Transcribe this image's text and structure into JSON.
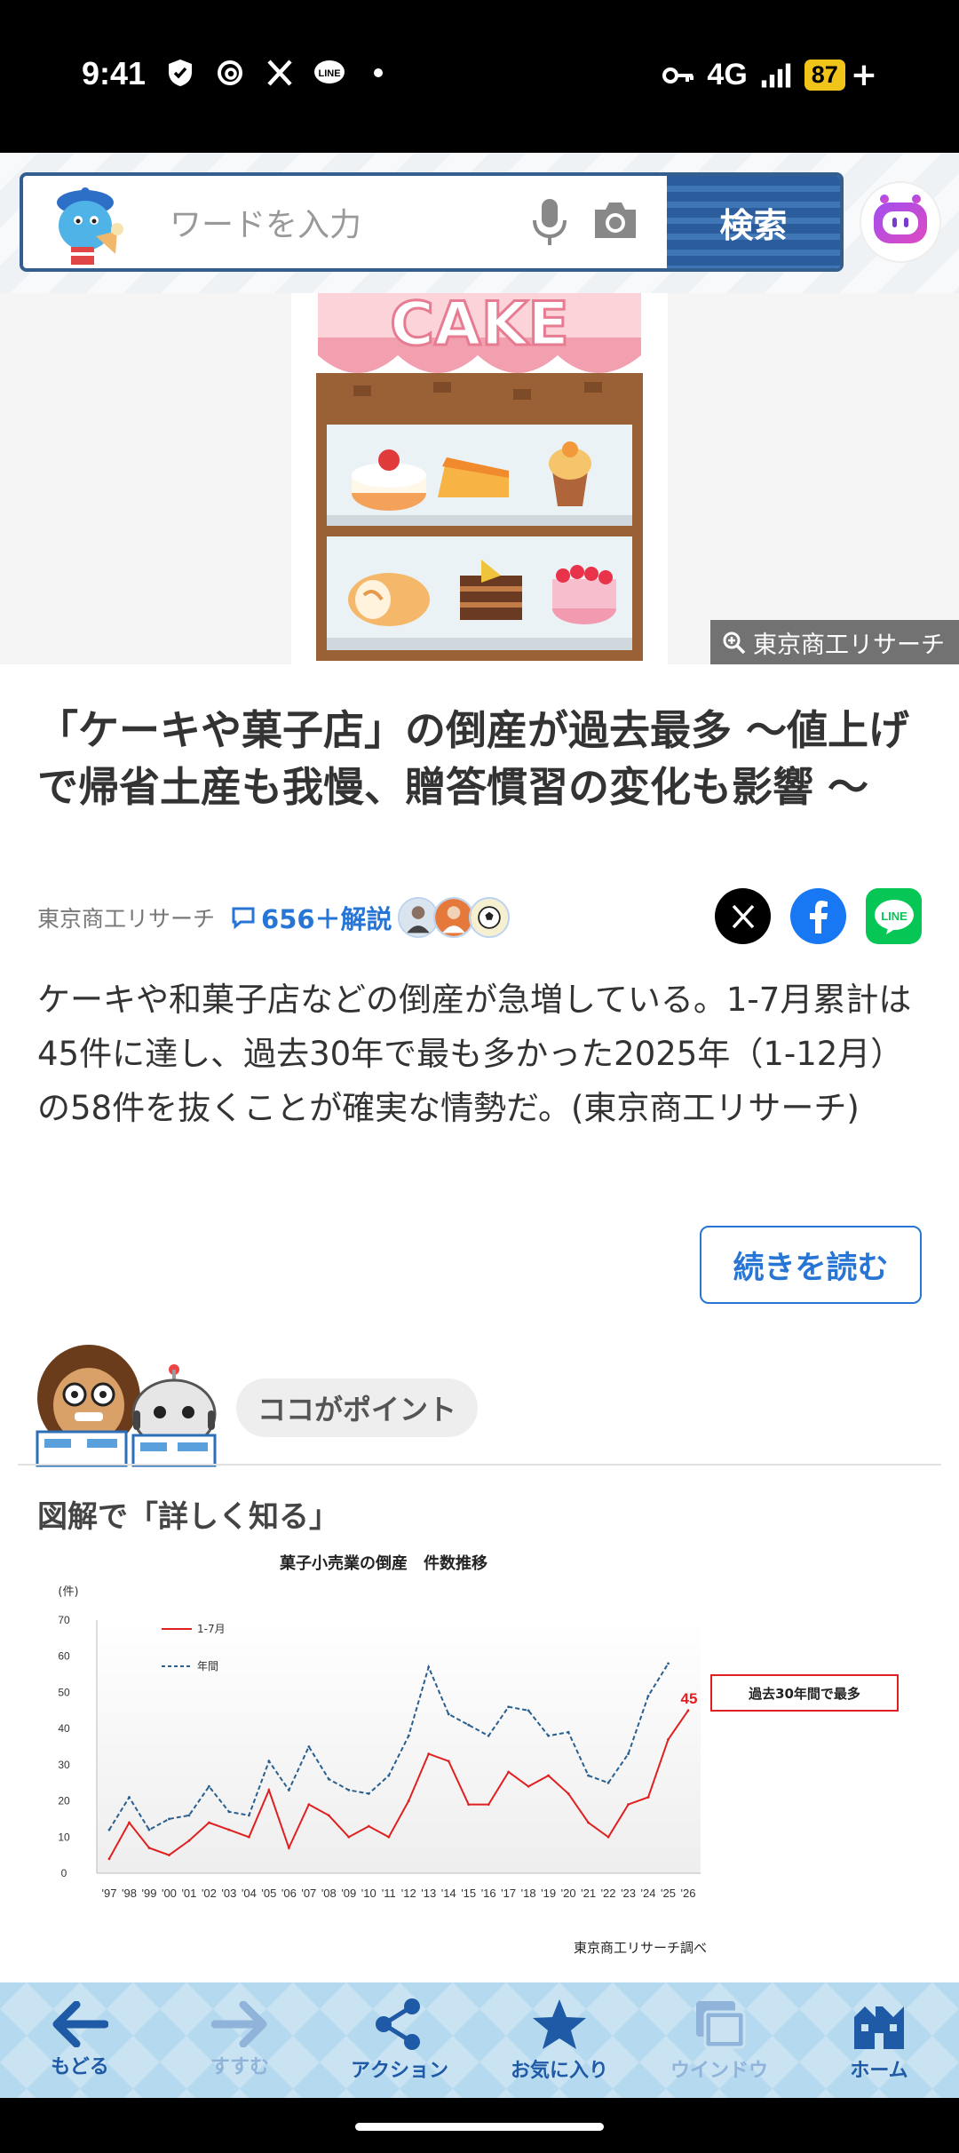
{
  "status_bar": {
    "time": "9:41",
    "network": "4G",
    "battery": "87",
    "battery_plus": "+"
  },
  "search": {
    "placeholder": "ワードを入力",
    "button_label": "検索"
  },
  "hero": {
    "sign_text": "CAKE",
    "credit": "東京商工リサーチ"
  },
  "article": {
    "headline": "「ケーキや菓子店」の倒産が過去最多 〜値上げで帰省土産も我慢、贈答慣習の変化も影響 〜",
    "source": "東京商工リサーチ",
    "comment_count": "656＋解説",
    "summary": "ケーキや和菓子店などの倒産が急増している。1-7月累計は45件に達し、過去30年で最も多かった2025年（1-12月）の58件を抜くことが確実な情勢だ。(東京商工リサーチ)",
    "read_more": "続きを読む"
  },
  "point": {
    "label": "ココがポイント"
  },
  "section": {
    "title": "図解で「詳しく知る」"
  },
  "chart_data": {
    "type": "line",
    "title": "菓子小売業の倒産　件数推移",
    "ylabel": "(件)",
    "ylim": [
      0,
      70
    ],
    "yticks": [
      0,
      10,
      20,
      30,
      40,
      50,
      60,
      70
    ],
    "categories": [
      "'97",
      "'98",
      "'99",
      "'00",
      "'01",
      "'02",
      "'03",
      "'04",
      "'05",
      "'06",
      "'07",
      "'08",
      "'09",
      "'10",
      "'11",
      "'12",
      "'13",
      "'14",
      "'15",
      "'16",
      "'17",
      "'18",
      "'19",
      "'20",
      "'21",
      "'22",
      "'23",
      "'24",
      "'25",
      "'26"
    ],
    "series": [
      {
        "name": "1-7月",
        "color": "#e02020",
        "style": "solid",
        "values": [
          4,
          14,
          7,
          5,
          9,
          14,
          12,
          10,
          23,
          7,
          19,
          16,
          10,
          13,
          10,
          20,
          33,
          31,
          19,
          19,
          28,
          24,
          27,
          22,
          14,
          10,
          19,
          21,
          37,
          45
        ]
      },
      {
        "name": "年間",
        "color": "#2a5f8f",
        "style": "dashed",
        "values": [
          12,
          21,
          12,
          15,
          16,
          24,
          17,
          16,
          31,
          23,
          35,
          26,
          23,
          22,
          27,
          38,
          57,
          44,
          41,
          38,
          46,
          45,
          38,
          39,
          27,
          25,
          33,
          49,
          58,
          null
        ]
      }
    ],
    "data_label": "45",
    "annotation": "過去30年間で最多",
    "source_note": "東京商工リサーチ調べ",
    "grid": false,
    "legend": "top-left"
  },
  "bottom_nav": {
    "items": [
      {
        "label": "もどる",
        "icon": "back-arrow-icon"
      },
      {
        "label": "すすむ",
        "icon": "forward-arrow-icon"
      },
      {
        "label": "アクション",
        "icon": "share-icon"
      },
      {
        "label": "お気に入り",
        "icon": "star-icon"
      },
      {
        "label": "ウインドウ",
        "icon": "window-icon"
      },
      {
        "label": "ホーム",
        "icon": "home-icon"
      }
    ]
  }
}
